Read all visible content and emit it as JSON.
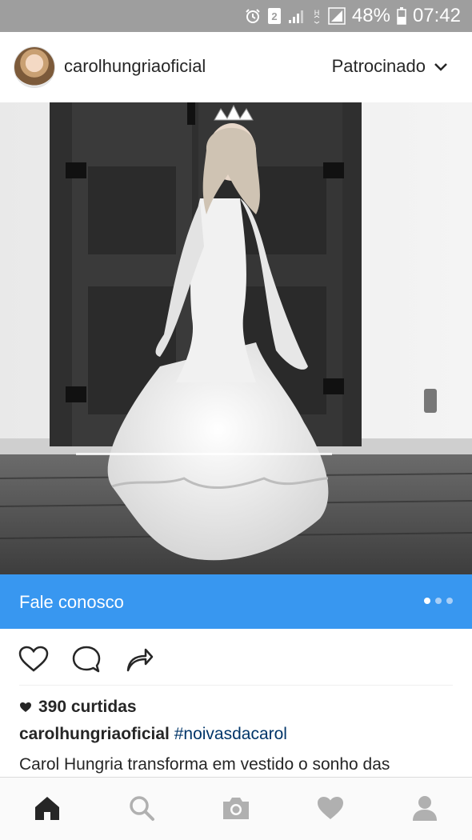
{
  "status_bar": {
    "battery": "48%",
    "time": "07:42",
    "icons": [
      "alarm-icon",
      "sim-2-icon",
      "signal-icon",
      "data-icon",
      "signal-icon",
      "battery-icon"
    ]
  },
  "post": {
    "username": "carolhungriaoficial",
    "sponsored_label": "Patrocinado",
    "cta_label": "Fale conosco",
    "likes": "390 curtidas",
    "caption_user": "carolhungriaoficial",
    "caption_tag": "#noivasdacarol",
    "caption_text": "Carol Hungria transforma em vestido o sonho das"
  },
  "carousel": {
    "count": 3,
    "active": 1
  },
  "colors": {
    "accent": "#3897f0",
    "status_bar": "#9e9e9e",
    "hashtag": "#003569"
  },
  "bottom_nav": [
    "home-icon",
    "search-icon",
    "camera-icon",
    "heart-icon",
    "profile-icon"
  ]
}
